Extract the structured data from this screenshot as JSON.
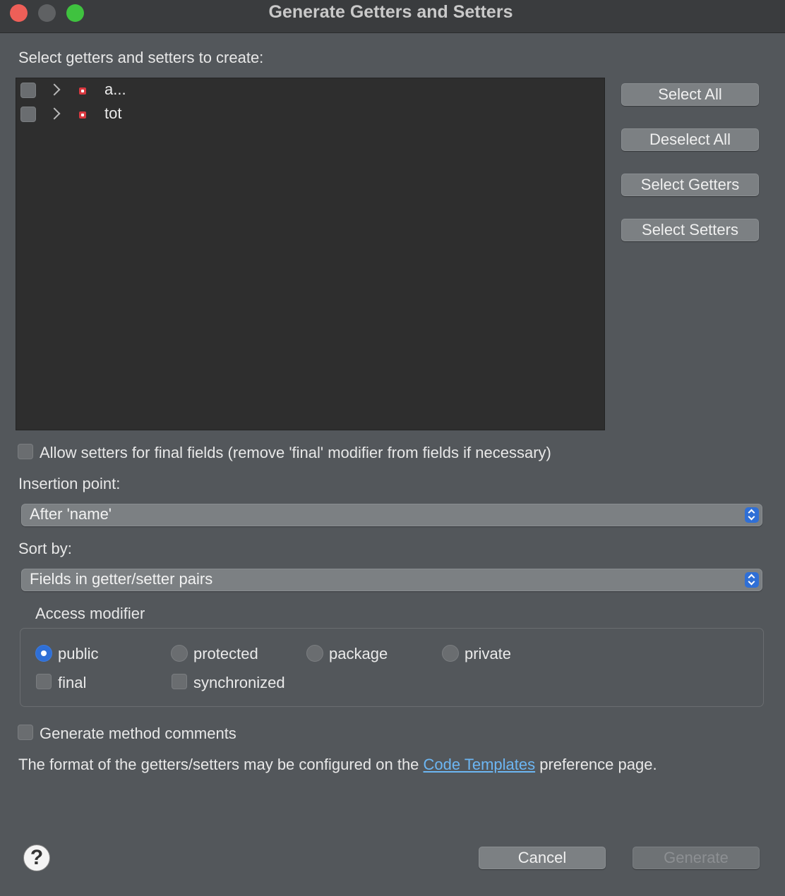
{
  "window": {
    "title": "Generate Getters and Setters"
  },
  "tree": {
    "heading": "Select getters and setters to create:",
    "items": [
      {
        "label": "a...",
        "checked": false,
        "icon": "private-field-icon"
      },
      {
        "label": "tot",
        "checked": false,
        "icon": "private-field-icon"
      }
    ]
  },
  "side_buttons": {
    "select_all": "Select All",
    "deselect_all": "Deselect All",
    "select_getters": "Select Getters",
    "select_setters": "Select Setters"
  },
  "allow_final": {
    "label": "Allow setters for final fields (remove 'final' modifier from fields if necessary)",
    "checked": false
  },
  "insertion": {
    "label": "Insertion point:",
    "value": "After 'name'"
  },
  "sort": {
    "label": "Sort by:",
    "value": "Fields in getter/setter pairs"
  },
  "access": {
    "label": "Access modifier",
    "options": [
      "public",
      "protected",
      "package",
      "private"
    ],
    "selected": "public",
    "final_label": "final",
    "synchronized_label": "synchronized"
  },
  "comments": {
    "label": "Generate method comments",
    "checked": false
  },
  "footer_note": {
    "before": "The format of the getters/setters may be configured on the ",
    "link": "Code Templates",
    "after": " preference page."
  },
  "buttons": {
    "help": "?",
    "cancel": "Cancel",
    "generate": "Generate"
  },
  "colors": {
    "accent": "#2f6fd6",
    "link": "#6cb6f3",
    "window_bg": "#53575b",
    "list_bg": "#2e2e2e"
  }
}
